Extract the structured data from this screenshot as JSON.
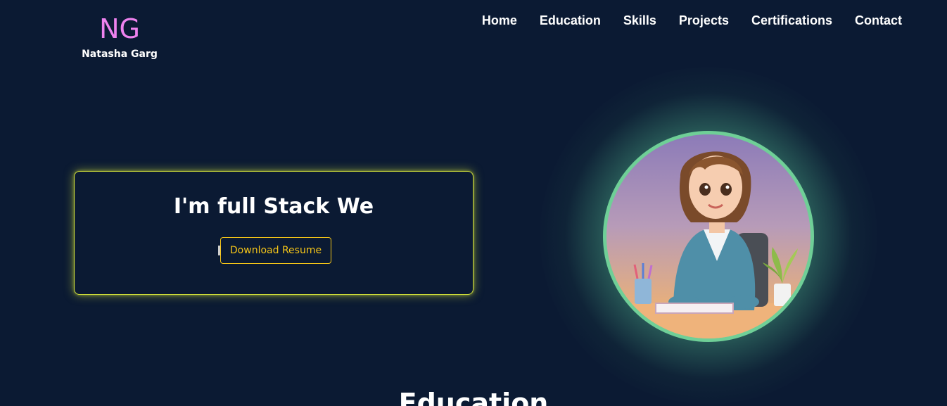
{
  "brand": {
    "initials": "NG",
    "name": "Natasha Garg"
  },
  "nav": {
    "items": [
      {
        "label": "Home"
      },
      {
        "label": "Education"
      },
      {
        "label": "Skills"
      },
      {
        "label": "Projects"
      },
      {
        "label": "Certifications"
      },
      {
        "label": "Contact"
      }
    ]
  },
  "hero": {
    "typed_text": "I'm full Stack We",
    "resume_button": "Download Resume"
  },
  "sections": {
    "education_heading": "Education"
  },
  "colors": {
    "background": "#0b1a33",
    "logo_accent": "#ee82ee",
    "card_border": "#cddc39",
    "button_accent": "#f5c518",
    "avatar_ring": "#6fcf97"
  }
}
